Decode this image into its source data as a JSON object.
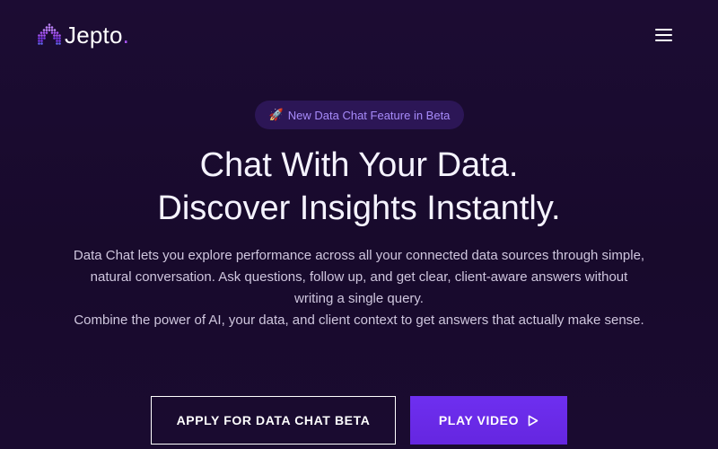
{
  "nav": {
    "brand": "Jepto",
    "brand_dot": ".",
    "logo_icon": "jepto-logo-icon",
    "menu_icon": "hamburger-menu-icon"
  },
  "hero": {
    "badge": {
      "icon": "rocket-icon",
      "icon_glyph": "🚀",
      "text": "New Data Chat Feature in Beta"
    },
    "headline_line1": "Chat With Your Data.",
    "headline_line2": "Discover Insights Instantly.",
    "description_p1": "Data Chat lets you explore performance across all your connected data sources through simple, natural conversation. Ask questions, follow up, and get clear, client-aware answers without writing a single query.",
    "description_p2": "Combine the power of AI, your data, and client context to get answers that actually make sense.",
    "cta_secondary": "APPLY FOR DATA CHAT BETA",
    "cta_primary": "PLAY VIDEO",
    "cta_primary_icon": "play-icon"
  },
  "colors": {
    "background": "#1a0c2f",
    "accent": "#6d28d9",
    "badge_bg": "#2c1656",
    "badge_text": "#a78bfa",
    "brand_dot": "#a855f7"
  }
}
